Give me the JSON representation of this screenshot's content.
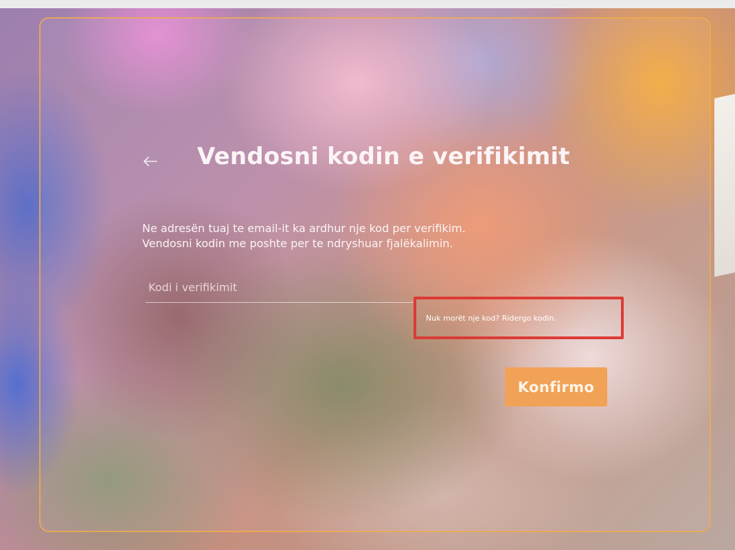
{
  "page": {
    "title": "Vendosni kodin e verifikimit",
    "description_line1": "Ne adresën tuaj te email-it ka ardhur nje kod per verifikim.",
    "description_line2": "Vendosni kodin me poshte per te ndryshuar fjalëkalimin.",
    "back_icon": "arrow-left-icon"
  },
  "form": {
    "code_placeholder": "Kodi i verifikimit",
    "code_value": "",
    "resend_text": "Nuk morët nje kod? Ridergo kodin.",
    "confirm_label": "Konfirmo"
  },
  "colors": {
    "card_border": "#f0aa50",
    "confirm_button": "#f1a256",
    "highlight_box": "#dc3a35",
    "text": "#fbf4f6"
  }
}
